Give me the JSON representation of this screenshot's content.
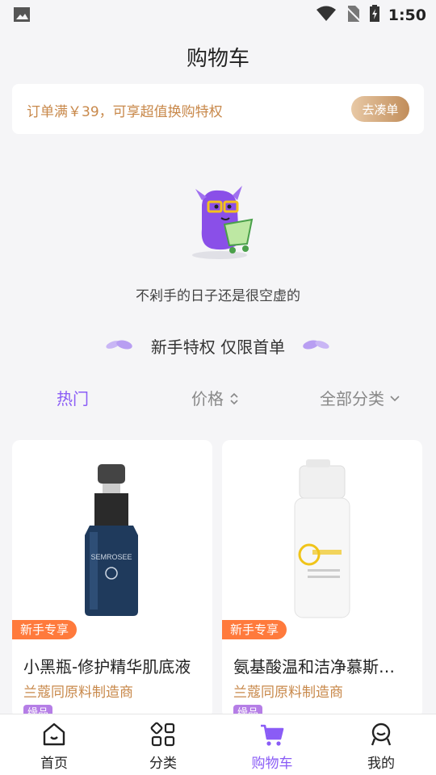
{
  "status_bar": {
    "time": "1:50"
  },
  "header": {
    "title": "购物车"
  },
  "promo": {
    "text": "订单满￥39，可享超值换购特权",
    "button_label": "去凑单"
  },
  "empty_state": {
    "message": "不剁手的日子还是很空虚的"
  },
  "section": {
    "title": "新手特权 仅限首单"
  },
  "filters": {
    "hot": "热门",
    "price": "价格",
    "category": "全部分类"
  },
  "products": [
    {
      "tag": "新手专享",
      "name": "小黑瓶-修护精华肌底液",
      "vendor": "兰蔻同原料制造商",
      "badge": "缲品",
      "brand_text": "SEMROSEE"
    },
    {
      "tag": "新手专享",
      "name": "氨基酸温和洁净慕斯…",
      "vendor": "兰蔻同原料制造商",
      "badge": "缲品"
    }
  ],
  "tabs": [
    {
      "label": "首页",
      "icon": "home-icon"
    },
    {
      "label": "分类",
      "icon": "category-icon"
    },
    {
      "label": "购物车",
      "icon": "cart-icon",
      "active": true
    },
    {
      "label": "我的",
      "icon": "profile-icon"
    }
  ],
  "colors": {
    "accent": "#8a5cf6",
    "gold": "#c8884a",
    "tag": "#ff7a3c"
  }
}
